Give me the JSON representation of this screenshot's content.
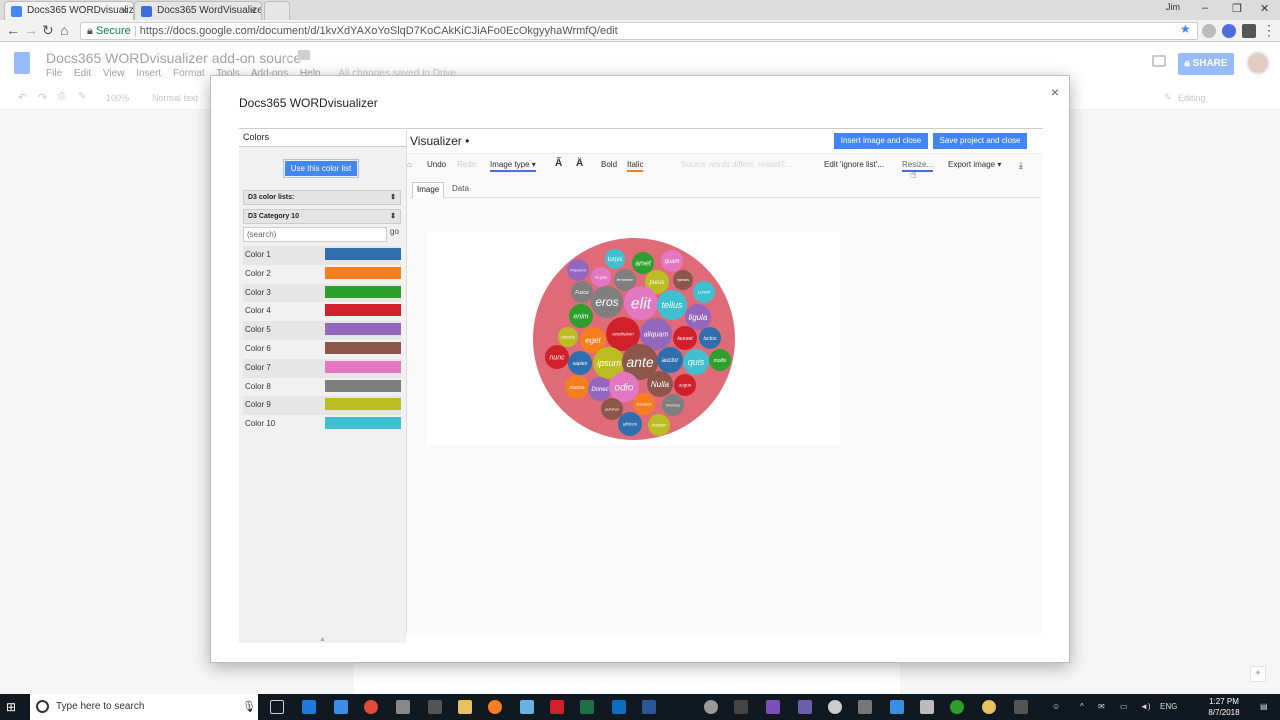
{
  "browser": {
    "tabs": [
      {
        "label": "Docs365 WORDvisualize",
        "close": "×"
      },
      {
        "label": "Docs365 WordVisualizer",
        "close": "×"
      }
    ],
    "user": "Jim",
    "secure_label": "Secure",
    "url": "https://docs.google.com/document/d/1kvXdYAXoYoSlqD7KoCAkKiCJiAFo0EcOkgyyhaWrmfQ/edit"
  },
  "docs": {
    "title": "Docs365 WORDvisualizer add-on source",
    "menu": [
      "File",
      "Edit",
      "View",
      "Insert",
      "Format",
      "Tools",
      "Add-ons",
      "Help",
      "All changes saved in Drive"
    ],
    "share_label": "SHARE",
    "zoom": "100%",
    "style": "Normal text",
    "mode": "Editing"
  },
  "dialog": {
    "title": "Docs365 WORDvisualizer",
    "close": "×",
    "colors_panel": {
      "header": "Colors",
      "use_button": "Use this color list",
      "lists_label": "D3 color lists:",
      "list_value": "D3 Category 10",
      "search_placeholder": "(search)",
      "go_label": "go",
      "colors": [
        {
          "name": "Color 1",
          "hex": "#2f6fad"
        },
        {
          "name": "Color 2",
          "hex": "#f57f20"
        },
        {
          "name": "Color 3",
          "hex": "#2ca02c"
        },
        {
          "name": "Color 4",
          "hex": "#d0202a"
        },
        {
          "name": "Color 5",
          "hex": "#9467bd"
        },
        {
          "name": "Color 6",
          "hex": "#8c564b"
        },
        {
          "name": "Color 7",
          "hex": "#e377c2"
        },
        {
          "name": "Color 8",
          "hex": "#7f7f7f"
        },
        {
          "name": "Color 9",
          "hex": "#bcbd22"
        },
        {
          "name": "Color 10",
          "hex": "#3fbfcf"
        }
      ]
    },
    "visualizer": {
      "title": "Visualizer",
      "title_mark": "•",
      "insert_button": "Insert image and close",
      "save_button": "Save project and close",
      "toolbar": {
        "undo": "Undo",
        "redo": "Redo",
        "image_type": "Image type ▾",
        "bold": "Bold",
        "italic": "Italic",
        "status": "Source words differs, reload?...",
        "edit_ignore": "Edit 'ignore list'...",
        "resize": "Resize...",
        "export": "Export image ▾"
      },
      "tabs": [
        "Image",
        "Data"
      ],
      "bubble_bg": "#e06b78",
      "bubbles": [
        {
          "w": "turpis",
          "c": "#3fbfcf"
        },
        {
          "w": "amet",
          "c": "#2ca02c"
        },
        {
          "w": "quam",
          "c": "#e377c2"
        },
        {
          "w": "Praesent",
          "c": "#9467bd"
        },
        {
          "w": "feugiat",
          "c": "#e377c2"
        },
        {
          "w": "fermentum",
          "c": "#7f7f7f"
        },
        {
          "w": "purus",
          "c": "#bcbd22"
        },
        {
          "w": "egestas",
          "c": "#8c564b"
        },
        {
          "w": "Fusce",
          "c": "#7f7f7f"
        },
        {
          "w": "Lorem",
          "c": "#3fbfcf"
        },
        {
          "w": "eros",
          "c": "#7f7f7f"
        },
        {
          "w": "elit",
          "c": "#e377c2"
        },
        {
          "w": "tellus",
          "c": "#3fbfcf"
        },
        {
          "w": "enim",
          "c": "#2ca02c"
        },
        {
          "w": "ligula",
          "c": "#9467bd"
        },
        {
          "w": "vestibulum",
          "c": "#d0202a"
        },
        {
          "w": "aliquam",
          "c": "#9467bd"
        },
        {
          "w": "laoreet",
          "c": "#d0202a"
        },
        {
          "w": "luctus",
          "c": "#2f6fad"
        },
        {
          "w": "mauris",
          "c": "#bcbd22"
        },
        {
          "w": "eget",
          "c": "#f57f20"
        },
        {
          "w": "nunc",
          "c": "#d0202a"
        },
        {
          "w": "sapien",
          "c": "#2f6fad"
        },
        {
          "w": "ipsum",
          "c": "#bcbd22"
        },
        {
          "w": "ante",
          "c": "#8c564b"
        },
        {
          "w": "auctor",
          "c": "#2f6fad"
        },
        {
          "w": "quis",
          "c": "#3fbfcf"
        },
        {
          "w": "mollis",
          "c": "#2ca02c"
        },
        {
          "w": "massa",
          "c": "#f57f20"
        },
        {
          "w": "Donec",
          "c": "#9467bd"
        },
        {
          "w": "odio",
          "c": "#e377c2"
        },
        {
          "w": "Nulla",
          "c": "#8c564b"
        },
        {
          "w": "augue",
          "c": "#d0202a"
        },
        {
          "w": "tincidunt",
          "c": "#f57f20"
        },
        {
          "w": "pulvinar",
          "c": "#8c564b"
        },
        {
          "w": "rhoncus",
          "c": "#7f7f7f"
        },
        {
          "w": "ultrices",
          "c": "#2f6fad"
        },
        {
          "w": "tempor",
          "c": "#bcbd22"
        }
      ]
    }
  },
  "taskbar": {
    "search_placeholder": "Type here to search",
    "lang": "ENG",
    "time": "1:27 PM",
    "date": "8/7/2018"
  }
}
